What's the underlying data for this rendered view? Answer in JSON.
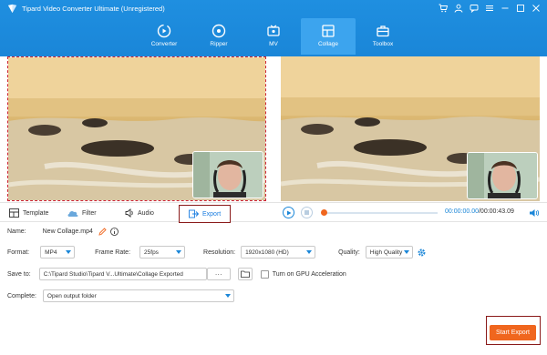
{
  "app": {
    "title": "Tipard Video Converter Ultimate (Unregistered)"
  },
  "nav": {
    "items": [
      {
        "label": "Converter",
        "active": false
      },
      {
        "label": "Ripper",
        "active": false
      },
      {
        "label": "MV",
        "active": false
      },
      {
        "label": "Collage",
        "active": true
      },
      {
        "label": "Toolbox",
        "active": false
      }
    ]
  },
  "tabs": {
    "template": "Template",
    "filter": "Filter",
    "audio": "Audio",
    "export": "Export"
  },
  "player": {
    "current": "00:00:00.00",
    "total": "/00:00:43.09",
    "progress": 0.0
  },
  "settings": {
    "name_label": "Name:",
    "name_value": "New Collage.mp4",
    "format_label": "Format:",
    "format_value": "MP4",
    "framerate_label": "Frame Rate:",
    "framerate_value": "25fps",
    "resolution_label": "Resolution:",
    "resolution_value": "1920x1080 (HD)",
    "quality_label": "Quality:",
    "quality_value": "High Quality",
    "saveto_label": "Save to:",
    "saveto_value": "C:\\Tipard Studio\\Tipard V...Ultimate\\Collage Exported",
    "browse_label": "···",
    "gpu_label": "Turn on GPU Acceleration",
    "complete_label": "Complete:",
    "complete_value": "Open output folder"
  },
  "actions": {
    "start_export": "Start Export"
  },
  "colors": {
    "header": "#1a86d8",
    "accent": "#f0661e",
    "highlight_border": "#8a1a1a"
  }
}
